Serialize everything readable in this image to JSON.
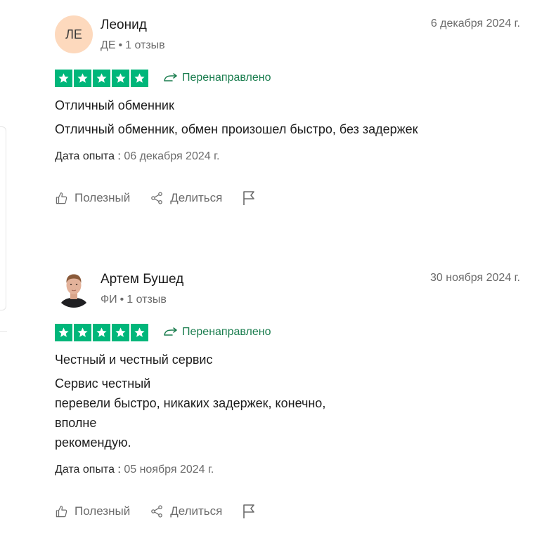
{
  "reviews": [
    {
      "author": "Леонид",
      "avatar_initials": "ЛЕ",
      "country": "ДЕ",
      "reviews_count": "1 отзыв",
      "date": "6 декабря 2024 г.",
      "rating": 5,
      "redirect_label": "Перенаправлено",
      "title": "Отличный обменник",
      "body_lines": [
        "Отличный обменник, обмен произошел быстро, без задержек"
      ],
      "experience_label": "Дата опыта :",
      "experience_date": "06 декабря 2024 г.",
      "useful_label": "Полезный",
      "share_label": "Делиться"
    },
    {
      "author": "Артем Бушед",
      "country": "ФИ",
      "reviews_count": "1 отзыв",
      "date": "30 ноября 2024 г.",
      "rating": 5,
      "redirect_label": "Перенаправлено",
      "title": "Честный и честный сервис",
      "body_lines": [
        "Сервис честный",
        "перевели быстро, никаких задержек, конечно,",
        "вполне",
        "рекомендую."
      ],
      "experience_label": "Дата опыта :",
      "experience_date": "05 ноября 2024 г.",
      "useful_label": "Полезный",
      "share_label": "Делиться"
    }
  ],
  "colors": {
    "star_bg": "#00b67a",
    "redirect_text": "#1a7d4e",
    "avatar_bg": "#fdd9bd",
    "muted_text": "#6b6b6b"
  },
  "icons": {
    "star": "star-icon",
    "redirect": "redirect-arrow-icon",
    "useful": "thumbs-up-icon",
    "share": "share-icon",
    "report": "flag-icon"
  }
}
